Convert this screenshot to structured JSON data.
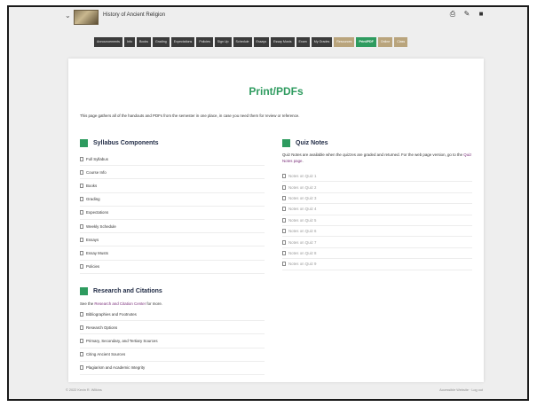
{
  "header": {
    "site_title": "History of Ancient Religion",
    "icons": [
      "print-icon",
      "edit-icon",
      "square-icon"
    ]
  },
  "nav": {
    "items": [
      {
        "label": "Announcements",
        "style": "dark"
      },
      {
        "label": "Info",
        "style": "dark"
      },
      {
        "label": "Books",
        "style": "dark"
      },
      {
        "label": "Grading",
        "style": "dark"
      },
      {
        "label": "Expectations",
        "style": "dark"
      },
      {
        "label": "Policies",
        "style": "dark"
      },
      {
        "label": "Sign Up",
        "style": "dark"
      },
      {
        "label": "Schedule",
        "style": "dark"
      },
      {
        "label": "Essays",
        "style": "dark"
      },
      {
        "label": "Essay Musts",
        "style": "dark"
      },
      {
        "label": "Exam",
        "style": "dark"
      },
      {
        "label": "My Grades",
        "style": "dark"
      },
      {
        "label": "Resources",
        "style": "tan"
      },
      {
        "label": "Print/PDF",
        "style": "active"
      },
      {
        "label": "Online",
        "style": "tan"
      },
      {
        "label": "Class",
        "style": "tan"
      }
    ],
    "colors": {
      "dark": "#3b3b3b",
      "tan": "#b9a47c",
      "active": "#2e9b5f"
    }
  },
  "page": {
    "title": "Print/PDFs",
    "intro": "This page gathers all of the handouts and PDFs from the semester in one place, in case you need them for review or reference."
  },
  "syllabus": {
    "title": "Syllabus Components",
    "items": [
      "Full Syllabus",
      "Course Info",
      "Books",
      "Grading",
      "Expectations",
      "Weekly Schedule",
      "Essays",
      "Essay Musts",
      "Policies"
    ]
  },
  "research": {
    "title": "Research and Citations",
    "desc_prefix": "See the ",
    "desc_link": "Research and Citation Center",
    "desc_suffix": " for more.",
    "items": [
      "Bibliographies and Footnotes",
      "Research Options",
      "Primary, Secondary, and Tertiary Sources",
      "Citing Ancient Sources",
      "Plagiarism and Academic Integrity"
    ]
  },
  "quiz": {
    "title": "Quiz Notes",
    "desc_prefix": "Quiz Notes are available when the quizzes are graded and returned. For the web page version, go to the ",
    "desc_link": "Quiz Notes page",
    "desc_suffix": ".",
    "items": [
      "Notes on Quiz 1",
      "Notes on Quiz 2",
      "Notes on Quiz 3",
      "Notes on Quiz 4",
      "Notes on Quiz 5",
      "Notes on Quiz 6",
      "Notes on Quiz 7",
      "Notes on Quiz 8",
      "Notes on Quiz 9"
    ]
  },
  "footer": {
    "left": "© 2022 Kevin R. Wilkins",
    "right": "Accessible Website · Log out"
  },
  "theme": {
    "accent": "#2e9b5f",
    "heading": "#1f2a44",
    "link": "#7a2f7a"
  }
}
